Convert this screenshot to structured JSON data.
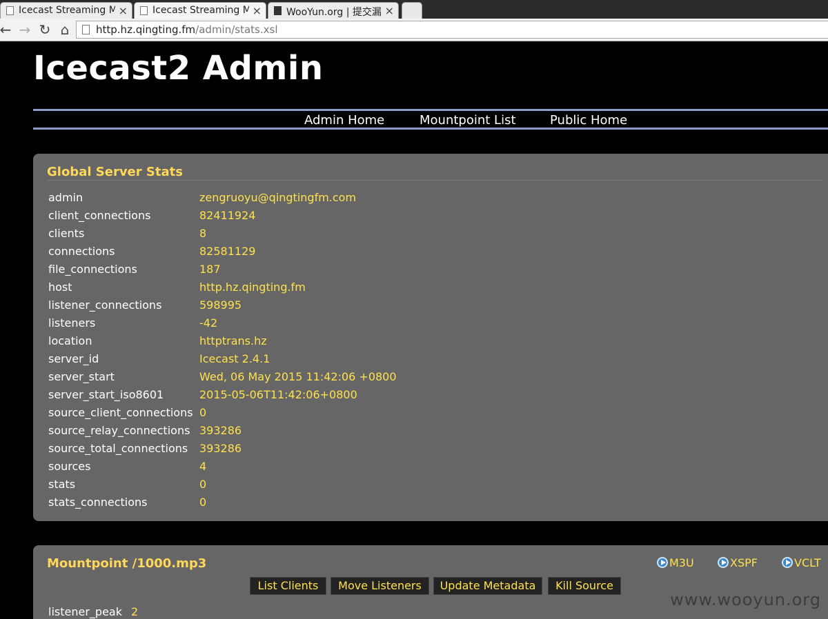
{
  "browser": {
    "tabs": [
      {
        "label": "Icecast Streaming Me"
      },
      {
        "label": "Icecast Streaming Me"
      },
      {
        "label": "WooYun.org | 提交漏"
      }
    ],
    "url_host": "http.hz.qingting.fm",
    "url_path": "/admin/stats.xsl"
  },
  "header": {
    "title": "Icecast2 Admin",
    "nav": [
      "Admin Home",
      "Mountpoint List",
      "Public Home"
    ]
  },
  "global_stats": {
    "title": "Global Server Stats",
    "rows": [
      {
        "key": "admin",
        "value": "zengruoyu@qingtingfm.com"
      },
      {
        "key": "client_connections",
        "value": "82411924"
      },
      {
        "key": "clients",
        "value": "8"
      },
      {
        "key": "connections",
        "value": "82581129"
      },
      {
        "key": "file_connections",
        "value": "187"
      },
      {
        "key": "host",
        "value": "http.hz.qingting.fm"
      },
      {
        "key": "listener_connections",
        "value": "598995"
      },
      {
        "key": "listeners",
        "value": "-42"
      },
      {
        "key": "location",
        "value": "httptrans.hz"
      },
      {
        "key": "server_id",
        "value": "Icecast 2.4.1"
      },
      {
        "key": "server_start",
        "value": "Wed, 06 May 2015 11:42:06 +0800"
      },
      {
        "key": "server_start_iso8601",
        "value": "2015-05-06T11:42:06+0800"
      },
      {
        "key": "source_client_connections",
        "value": "0"
      },
      {
        "key": "source_relay_connections",
        "value": "393286"
      },
      {
        "key": "source_total_connections",
        "value": "393286"
      },
      {
        "key": "sources",
        "value": "4"
      },
      {
        "key": "stats",
        "value": "0"
      },
      {
        "key": "stats_connections",
        "value": "0"
      }
    ]
  },
  "mountpoint": {
    "title": "Mountpoint /1000.mp3",
    "playlists": [
      "M3U",
      "XSPF",
      "VCLT"
    ],
    "actions": [
      "List Clients",
      "Move Listeners",
      "Update Metadata",
      "Kill Source"
    ],
    "rows": [
      {
        "key": "listener_peak",
        "value": "2"
      }
    ]
  },
  "watermark": "www.wooyun.org"
}
